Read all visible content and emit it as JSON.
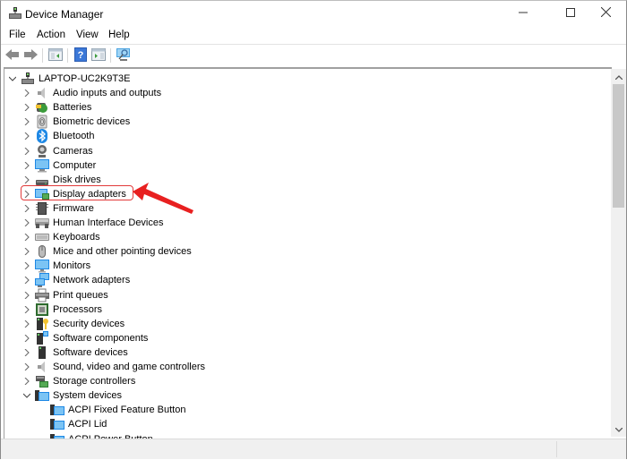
{
  "window": {
    "title": "Device Manager",
    "controls": {
      "minimize": "minimize",
      "maximize": "maximize",
      "close": "close"
    }
  },
  "menu": {
    "items": [
      "File",
      "Action",
      "View",
      "Help"
    ]
  },
  "toolbar": {
    "buttons": [
      {
        "name": "back",
        "icon": "arrow-left-icon"
      },
      {
        "name": "forward",
        "icon": "arrow-right-icon"
      },
      {
        "name": "show-hide-console-tree",
        "icon": "console-tree-icon"
      },
      {
        "name": "help",
        "icon": "help-icon"
      },
      {
        "name": "show-hide-action-pane",
        "icon": "action-pane-icon"
      },
      {
        "name": "scan-hardware-changes",
        "icon": "scan-monitor-icon"
      }
    ]
  },
  "tree": {
    "root": {
      "label": "LAPTOP-UC2K9T3E",
      "expanded": true
    },
    "categories": [
      {
        "label": "Audio inputs and outputs",
        "icon": "speaker-icon",
        "expanded": false
      },
      {
        "label": "Batteries",
        "icon": "battery-icon",
        "expanded": false
      },
      {
        "label": "Biometric devices",
        "icon": "fingerprint-icon",
        "expanded": false
      },
      {
        "label": "Bluetooth",
        "icon": "bluetooth-icon",
        "expanded": false
      },
      {
        "label": "Cameras",
        "icon": "camera-icon",
        "expanded": false
      },
      {
        "label": "Computer",
        "icon": "computer-icon",
        "expanded": false
      },
      {
        "label": "Disk drives",
        "icon": "disk-drive-icon",
        "expanded": false
      },
      {
        "label": "Display adapters",
        "icon": "display-adapter-icon",
        "expanded": false,
        "highlighted": true
      },
      {
        "label": "Firmware",
        "icon": "firmware-icon",
        "expanded": false
      },
      {
        "label": "Human Interface Devices",
        "icon": "hid-icon",
        "expanded": false
      },
      {
        "label": "Keyboards",
        "icon": "keyboard-icon",
        "expanded": false
      },
      {
        "label": "Mice and other pointing devices",
        "icon": "mouse-icon",
        "expanded": false
      },
      {
        "label": "Monitors",
        "icon": "monitor-icon",
        "expanded": false
      },
      {
        "label": "Network adapters",
        "icon": "network-adapter-icon",
        "expanded": false
      },
      {
        "label": "Print queues",
        "icon": "printer-icon",
        "expanded": false
      },
      {
        "label": "Processors",
        "icon": "processor-icon",
        "expanded": false
      },
      {
        "label": "Security devices",
        "icon": "security-device-icon",
        "expanded": false
      },
      {
        "label": "Software components",
        "icon": "software-component-icon",
        "expanded": false
      },
      {
        "label": "Software devices",
        "icon": "software-device-icon",
        "expanded": false
      },
      {
        "label": "Sound, video and game controllers",
        "icon": "speaker-icon",
        "expanded": false
      },
      {
        "label": "Storage controllers",
        "icon": "storage-controller-icon",
        "expanded": false
      },
      {
        "label": "System devices",
        "icon": "system-devices-icon",
        "expanded": true
      }
    ],
    "system_devices_children": [
      {
        "label": "ACPI Fixed Feature Button",
        "icon": "system-device-icon"
      },
      {
        "label": "ACPI Lid",
        "icon": "system-device-icon"
      },
      {
        "label": "ACPI Power Button",
        "icon": "system-device-icon"
      }
    ]
  },
  "annotation": {
    "target": "Display adapters",
    "color": "#e23b3b"
  }
}
